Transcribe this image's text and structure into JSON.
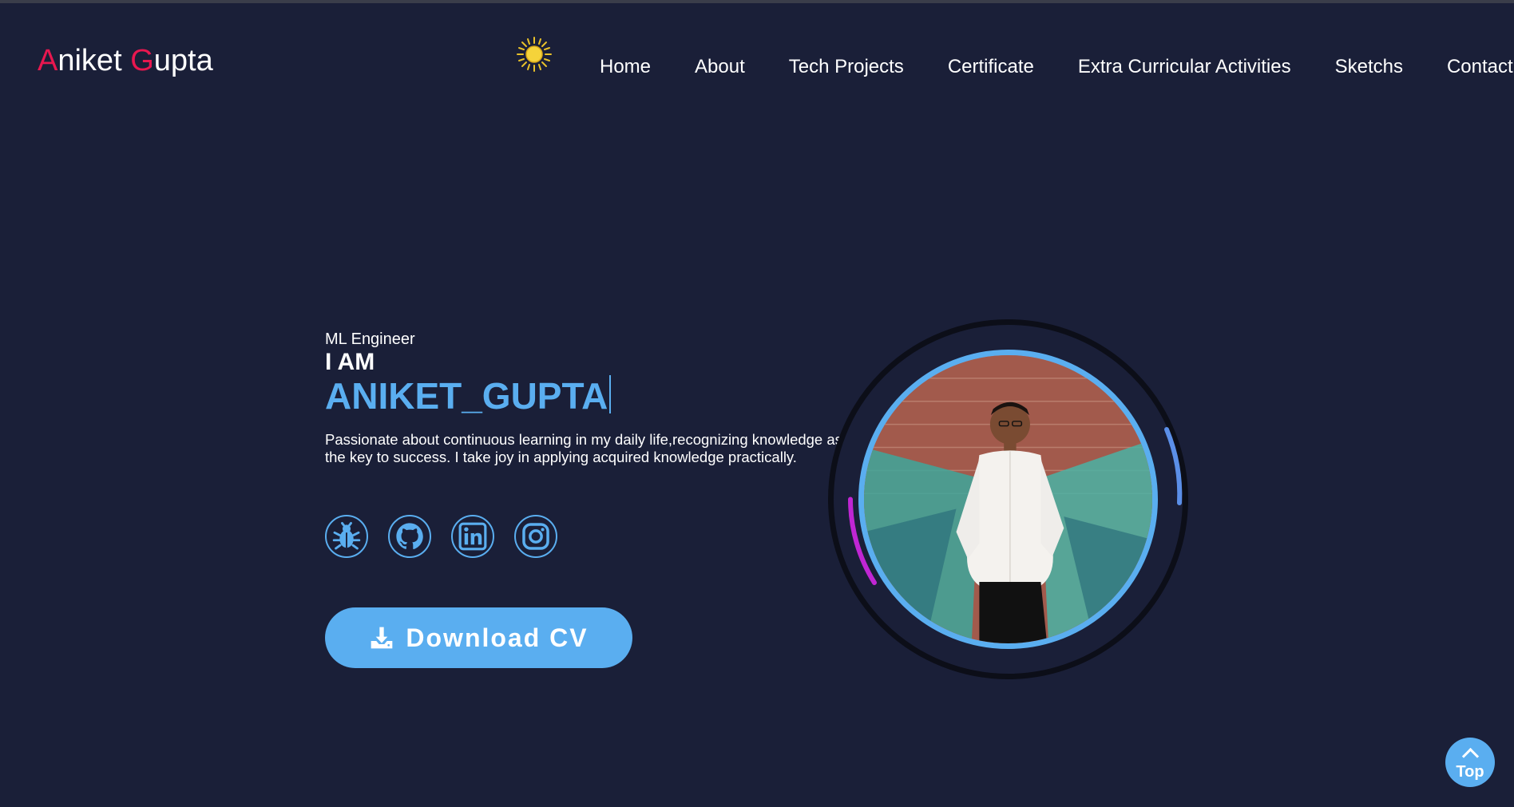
{
  "header": {
    "logo": {
      "first_initial": "A",
      "first_rest": "niket ",
      "last_initial": "G",
      "last_rest": "upta"
    },
    "theme_icon": "sun-icon",
    "nav": [
      {
        "label": "Home"
      },
      {
        "label": "About"
      },
      {
        "label": "Tech Projects"
      },
      {
        "label": "Certificate"
      },
      {
        "label": "Extra Curricular Activities"
      },
      {
        "label": "Sketchs"
      },
      {
        "label": "Contact"
      }
    ]
  },
  "hero": {
    "role": "ML Engineer",
    "intro": "I AM",
    "name": "ANIKET_GUPTA",
    "description": "Passionate about continuous learning in my daily life,recognizing knowledge as the key to success. I take joy in applying acquired knowledge practically.",
    "socials": [
      {
        "icon": "bug-icon"
      },
      {
        "icon": "github-icon"
      },
      {
        "icon": "linkedin-icon"
      },
      {
        "icon": "instagram-icon"
      }
    ],
    "cv_button": "Download CV"
  },
  "scroll_top": {
    "label": "Top"
  },
  "colors": {
    "background": "#1a1f38",
    "accent": "#5aaef0",
    "logo_initial": "#e8174f",
    "ring_magenta": "#c026d3",
    "ring_blue": "#5b8fe8"
  }
}
